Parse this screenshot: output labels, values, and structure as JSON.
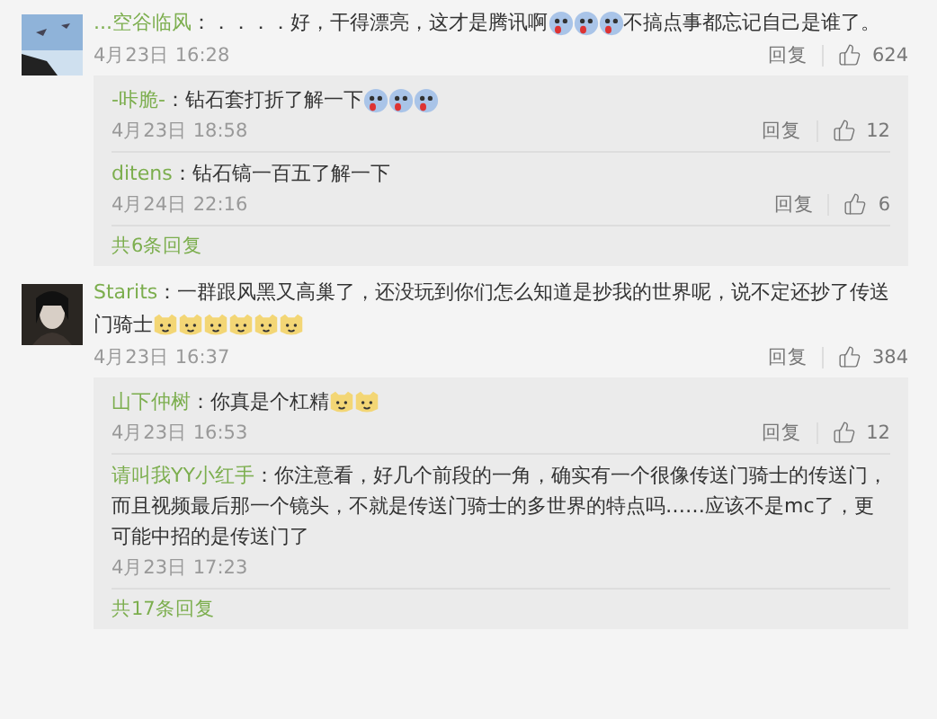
{
  "comments": [
    {
      "avatar": {
        "kind": "picture"
      },
      "user": "...空谷临风",
      "content": [
        {
          "kind": "text",
          "text": "：．．．．好，干得漂亮，这才是腾讯啊"
        },
        {
          "kind": "doge_emoji"
        },
        {
          "kind": "doge_emoji"
        },
        {
          "kind": "doge_emoji"
        },
        {
          "kind": "text",
          "text": "不搞点事都忘记自己是谁了。"
        }
      ],
      "time": "4月23日 16:28",
      "reply_label": "回复",
      "likes": "624",
      "replies": [
        {
          "user": "-咔脆-",
          "content": [
            {
              "kind": "text",
              "text": "：钻石套打折了解一下"
            },
            {
              "kind": "doge_emoji"
            },
            {
              "kind": "doge_emoji"
            },
            {
              "kind": "doge_emoji"
            }
          ],
          "time": "4月23日 18:58",
          "reply_label": "回复",
          "likes": "12"
        },
        {
          "user": "ditens",
          "content": [
            {
              "kind": "text",
              "text": "：钻石镐一百五了解一下"
            }
          ],
          "time": "4月24日 22:16",
          "reply_label": "回复",
          "likes": "6"
        }
      ],
      "more": "共6条回复"
    },
    {
      "avatar": {
        "kind": "picture"
      },
      "user": "Starits",
      "content": [
        {
          "kind": "text",
          "text": "：一群跟风黑又高巢了，还没玩到你们怎么知道是抄我的世界呢，说不定还抄了传送门骑士"
        },
        {
          "kind": "cat_emoji"
        },
        {
          "kind": "cat_emoji"
        },
        {
          "kind": "cat_emoji"
        },
        {
          "kind": "cat_emoji"
        },
        {
          "kind": "cat_emoji"
        },
        {
          "kind": "cat_emoji"
        }
      ],
      "time": "4月23日 16:37",
      "reply_label": "回复",
      "likes": "384",
      "replies": [
        {
          "user": "山下仲树",
          "content": [
            {
              "kind": "text",
              "text": "：你真是个杠精"
            },
            {
              "kind": "cat_emoji"
            },
            {
              "kind": "cat_emoji"
            }
          ],
          "time": "4月23日 16:53",
          "reply_label": "回复",
          "likes": "12"
        },
        {
          "user": "请叫我YY小红手",
          "content": [
            {
              "kind": "text",
              "text": "：你注意看，好几个前段的一角，确实有一个很像传送门骑士的传送门，而且视频最后那一个镜头，不就是传送门骑士的多世界的特点吗……应该不是mc了，更可能中招的是传送门了"
            }
          ],
          "time": "4月23日 17:23"
        }
      ],
      "more": "共17条回复"
    }
  ]
}
